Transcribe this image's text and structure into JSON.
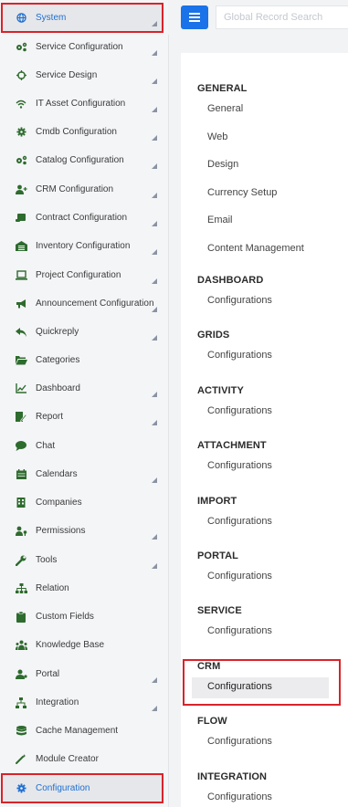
{
  "header": {
    "search_placeholder": "Global Record Search"
  },
  "sidebar": {
    "items": [
      {
        "label": "System",
        "icon": "globe-icon",
        "active": true,
        "chevron": true
      },
      {
        "label": "Service Configuration",
        "icon": "cogs-icon",
        "chevron": true
      },
      {
        "label": "Service Design",
        "icon": "crosshair-icon",
        "chevron": true
      },
      {
        "label": "IT Asset Configuration",
        "icon": "wifi-icon",
        "chevron": true
      },
      {
        "label": "Cmdb Configuration",
        "icon": "gear-icon",
        "chevron": true
      },
      {
        "label": "Catalog Configuration",
        "icon": "cogs-icon",
        "chevron": true
      },
      {
        "label": "CRM Configuration",
        "icon": "user-plus-icon",
        "chevron": true
      },
      {
        "label": "Contract Configuration",
        "icon": "scroll-icon",
        "chevron": true
      },
      {
        "label": "Inventory Configuration",
        "icon": "warehouse-icon",
        "chevron": true
      },
      {
        "label": "Project Configuration",
        "icon": "laptop-icon",
        "chevron": true
      },
      {
        "label": "Announcement Configuration",
        "icon": "megaphone-icon",
        "chevron": true
      },
      {
        "label": "Quickreply",
        "icon": "reply-icon",
        "chevron": true
      },
      {
        "label": "Categories",
        "icon": "folder-open-icon",
        "chevron": false
      },
      {
        "label": "Dashboard",
        "icon": "line-chart-icon",
        "chevron": true
      },
      {
        "label": "Report",
        "icon": "report-edit-icon",
        "chevron": true
      },
      {
        "label": "Chat",
        "icon": "chat-bubble-icon",
        "chevron": false
      },
      {
        "label": "Calendars",
        "icon": "calendar-icon",
        "chevron": true
      },
      {
        "label": "Companies",
        "icon": "building-icon",
        "chevron": false
      },
      {
        "label": "Permissions",
        "icon": "user-key-icon",
        "chevron": true
      },
      {
        "label": "Tools",
        "icon": "wrench-icon",
        "chevron": true
      },
      {
        "label": "Relation",
        "icon": "sitemap-icon",
        "chevron": false
      },
      {
        "label": "Custom Fields",
        "icon": "clipboard-icon",
        "chevron": false
      },
      {
        "label": "Knowledge Base",
        "icon": "users-icon",
        "chevron": false
      },
      {
        "label": "Portal",
        "icon": "user-icon",
        "chevron": true
      },
      {
        "label": "Integration",
        "icon": "network-icon",
        "chevron": true
      },
      {
        "label": "Cache Management",
        "icon": "database-icon",
        "chevron": false
      },
      {
        "label": "Module Creator",
        "icon": "magic-icon",
        "chevron": false
      },
      {
        "label": "Configuration",
        "icon": "gear-icon",
        "active": true,
        "chevron": false
      }
    ]
  },
  "main": {
    "sections": [
      {
        "title": "GENERAL",
        "links": [
          "General",
          "Web",
          "Design",
          "Currency Setup",
          "Email",
          "Content Management"
        ]
      },
      {
        "title": "DASHBOARD",
        "links": [
          "Configurations"
        ]
      },
      {
        "title": "GRIDS",
        "links": [
          "Configurations"
        ]
      },
      {
        "title": "ACTIVITY",
        "links": [
          "Configurations"
        ]
      },
      {
        "title": "ATTACHMENT",
        "links": [
          "Configurations"
        ]
      },
      {
        "title": "IMPORT",
        "links": [
          "Configurations"
        ]
      },
      {
        "title": "PORTAL",
        "links": [
          "Configurations"
        ]
      },
      {
        "title": "SERVICE",
        "links": [
          "Configurations"
        ]
      },
      {
        "title": "CRM",
        "links": [
          "Configurations"
        ],
        "selected": true
      },
      {
        "title": "FLOW",
        "links": [
          "Configurations"
        ]
      },
      {
        "title": "INTEGRATION",
        "links": [
          "Configurations"
        ]
      }
    ]
  },
  "colors": {
    "accent": "#1a73e8",
    "icon_green": "#2e6b2e",
    "highlight_red": "#d8232a"
  }
}
